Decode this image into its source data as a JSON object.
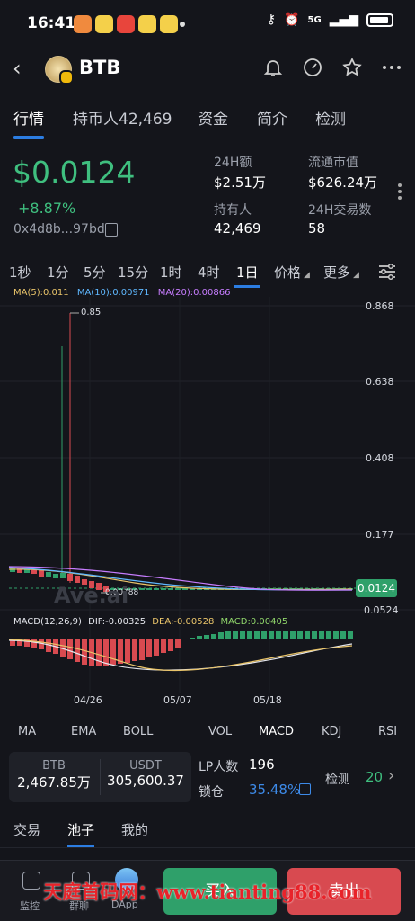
{
  "status_bar": {
    "time": "16:41",
    "network": "5G"
  },
  "header": {
    "token_name": "BTB"
  },
  "tabs": [
    "行情",
    "持币人42,469",
    "资金",
    "简介",
    "检测"
  ],
  "price": {
    "value": "$0.0124",
    "change": "+8.87%",
    "address": "0x4d8b...97bd"
  },
  "stats": {
    "vol24_label": "24H额",
    "vol24_value": "$2.51万",
    "mcap_label": "流通市值",
    "mcap_value": "$626.24万",
    "holders_label": "持有人",
    "holders_value": "42,469",
    "tx24_label": "24H交易数",
    "tx24_value": "58"
  },
  "intervals": [
    "1秒",
    "1分",
    "5分",
    "15分",
    "1时",
    "4时",
    "1日"
  ],
  "price_dropdown": "价格",
  "more_dropdown": "更多",
  "chart_data": {
    "type": "candlestick",
    "ma_legend": {
      "ma5": "MA(5):0.011",
      "ma10": "MA(10):0.00971",
      "ma20": "MA(20):0.00866"
    },
    "y_ticks": [
      "0.868",
      "0.638",
      "0.408",
      "0.177",
      "0.0524"
    ],
    "current_price_tag": "0.0124",
    "high_marker": "0.85",
    "low_marker": "0.00788",
    "watermark": "Ave.ai",
    "x_ticks": [
      "04/26",
      "05/07",
      "05/18"
    ],
    "macd_legend": {
      "title": "MACD(12,26,9)",
      "dif": "DIF:-0.00325",
      "dea": "DEA:-0.00528",
      "macd": "MACD:0.00405"
    },
    "colors": {
      "up": "#2fa06a",
      "down": "#d84a50",
      "ma5": "#e9c46a",
      "ma10": "#5fb8ff",
      "ma20": "#c77dff"
    }
  },
  "indicators": [
    "MA",
    "EMA",
    "BOLL",
    "VOL",
    "MACD",
    "KDJ",
    "RSI"
  ],
  "pool": {
    "token_label": "BTB",
    "token_value": "2,467.85万",
    "quote_label": "USDT",
    "quote_value": "305,600.37",
    "lp_label": "LP人数",
    "lp_value": "196",
    "lock_label": "锁仓",
    "lock_value": "35.48%",
    "detect_label": "检测",
    "detect_value": "20"
  },
  "subtabs": [
    "交易",
    "池子",
    "我的"
  ],
  "bottom_nav": {
    "monitor": "监控",
    "group": "群聊",
    "dapp": "DApp"
  },
  "actions": {
    "buy": "买入",
    "sell": "卖出"
  },
  "overlay_watermark": "天庭首码网：www.tianting88.com"
}
